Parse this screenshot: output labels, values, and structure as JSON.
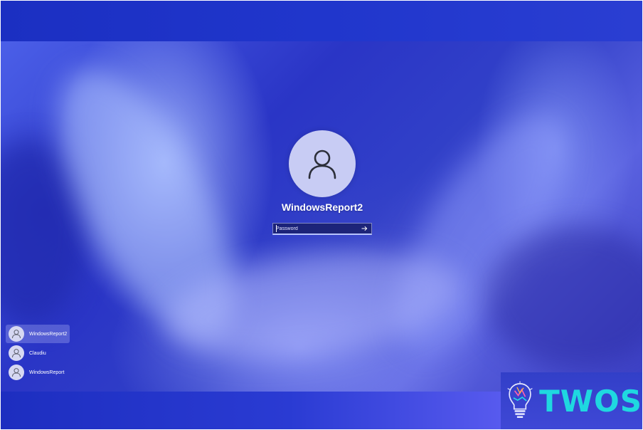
{
  "login": {
    "username": "WindowsReport2",
    "password_placeholder": "Password"
  },
  "users": [
    {
      "name": "WindowsReport2",
      "active": true
    },
    {
      "name": "Claudiu",
      "active": false
    },
    {
      "name": "WindowsReport",
      "active": false
    }
  ],
  "watermark": {
    "text": "TWOS"
  },
  "colors": {
    "avatar_bg": "#c8ccf4",
    "watermark_text": "#1fd8e0",
    "band": "#2036cc"
  },
  "icons": {
    "large_avatar": "user-icon",
    "submit": "arrow-right-icon",
    "watermark_logo": "lightbulb-icon"
  }
}
